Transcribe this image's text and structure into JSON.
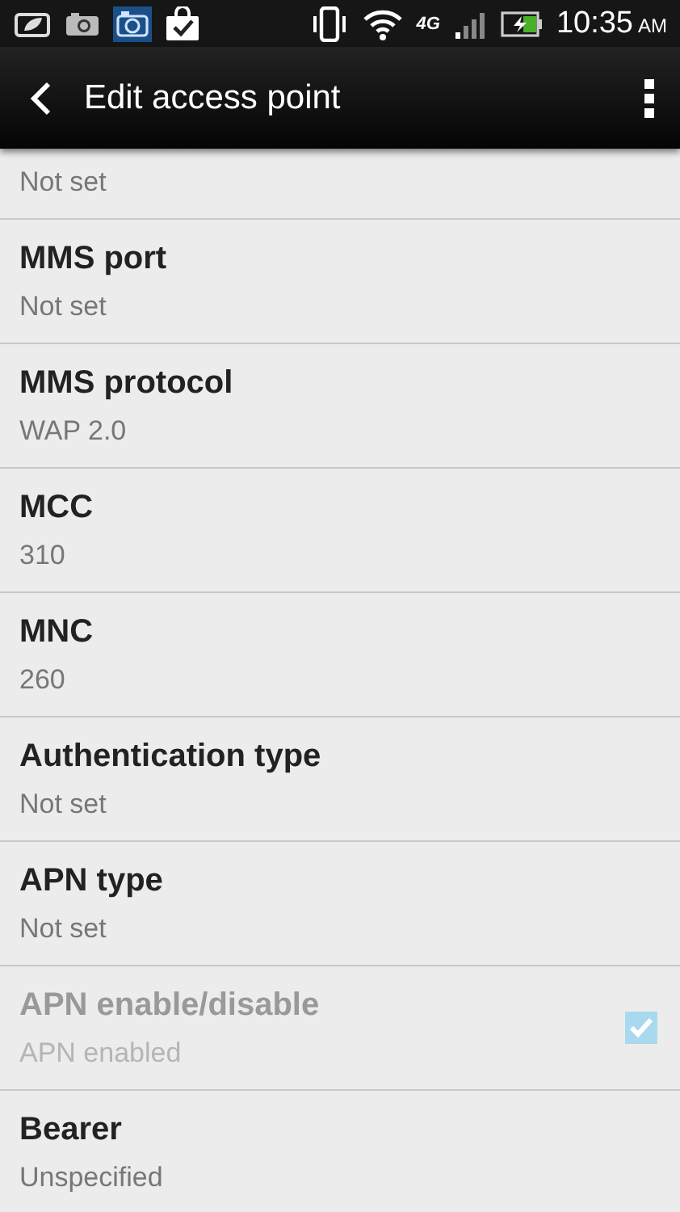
{
  "status_bar": {
    "time": "10:35",
    "meridiem": "AM",
    "network": "4G"
  },
  "action_bar": {
    "title": "Edit access point"
  },
  "partial_item": {
    "summary": "Not set"
  },
  "items": [
    {
      "kind": "text",
      "title": "MMS port",
      "summary": "Not set",
      "disabled": false
    },
    {
      "kind": "text",
      "title": "MMS protocol",
      "summary": "WAP 2.0",
      "disabled": false
    },
    {
      "kind": "text",
      "title": "MCC",
      "summary": "310",
      "disabled": false
    },
    {
      "kind": "text",
      "title": "MNC",
      "summary": "260",
      "disabled": false
    },
    {
      "kind": "text",
      "title": "Authentication type",
      "summary": "Not set",
      "disabled": false
    },
    {
      "kind": "text",
      "title": "APN type",
      "summary": "Not set",
      "disabled": false
    },
    {
      "kind": "checkbox",
      "title": "APN enable/disable",
      "summary": "APN enabled",
      "disabled": true,
      "checked": true
    },
    {
      "kind": "text",
      "title": "Bearer",
      "summary": "Unspecified",
      "disabled": false
    }
  ]
}
